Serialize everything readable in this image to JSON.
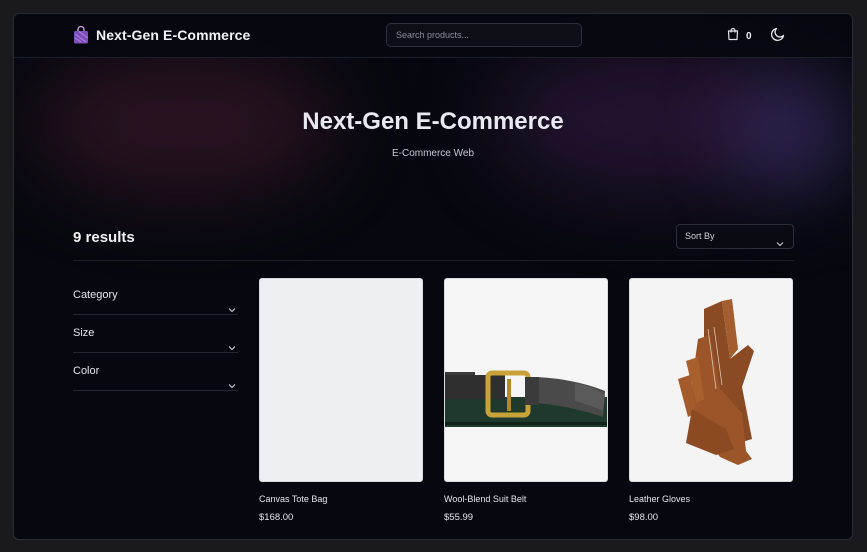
{
  "header": {
    "brand": "Next-Gen E-Commerce",
    "search_placeholder": "Search products...",
    "cart_count": "0"
  },
  "hero": {
    "title": "Next-Gen E-Commerce",
    "subtitle": "E-Commerce Web"
  },
  "results": {
    "count_label": "9 results",
    "sort_label": "Sort By"
  },
  "filters": [
    {
      "label": "Category"
    },
    {
      "label": "Size"
    },
    {
      "label": "Color"
    }
  ],
  "products": [
    {
      "name": "Canvas Tote Bag",
      "price": "$168.00",
      "image": "blank-product-image"
    },
    {
      "name": "Wool-Blend Suit Belt",
      "price": "$55.99",
      "image": "belt-image"
    },
    {
      "name": "Leather Gloves",
      "price": "$98.00",
      "image": "gloves-image"
    }
  ],
  "icons": {
    "brand": "shopping-bag-icon",
    "cart": "cart-icon",
    "theme": "moon-icon",
    "sort": "chevron-down-icon"
  },
  "colors": {
    "background": "#07080f",
    "accent": "#8b5cf6"
  }
}
